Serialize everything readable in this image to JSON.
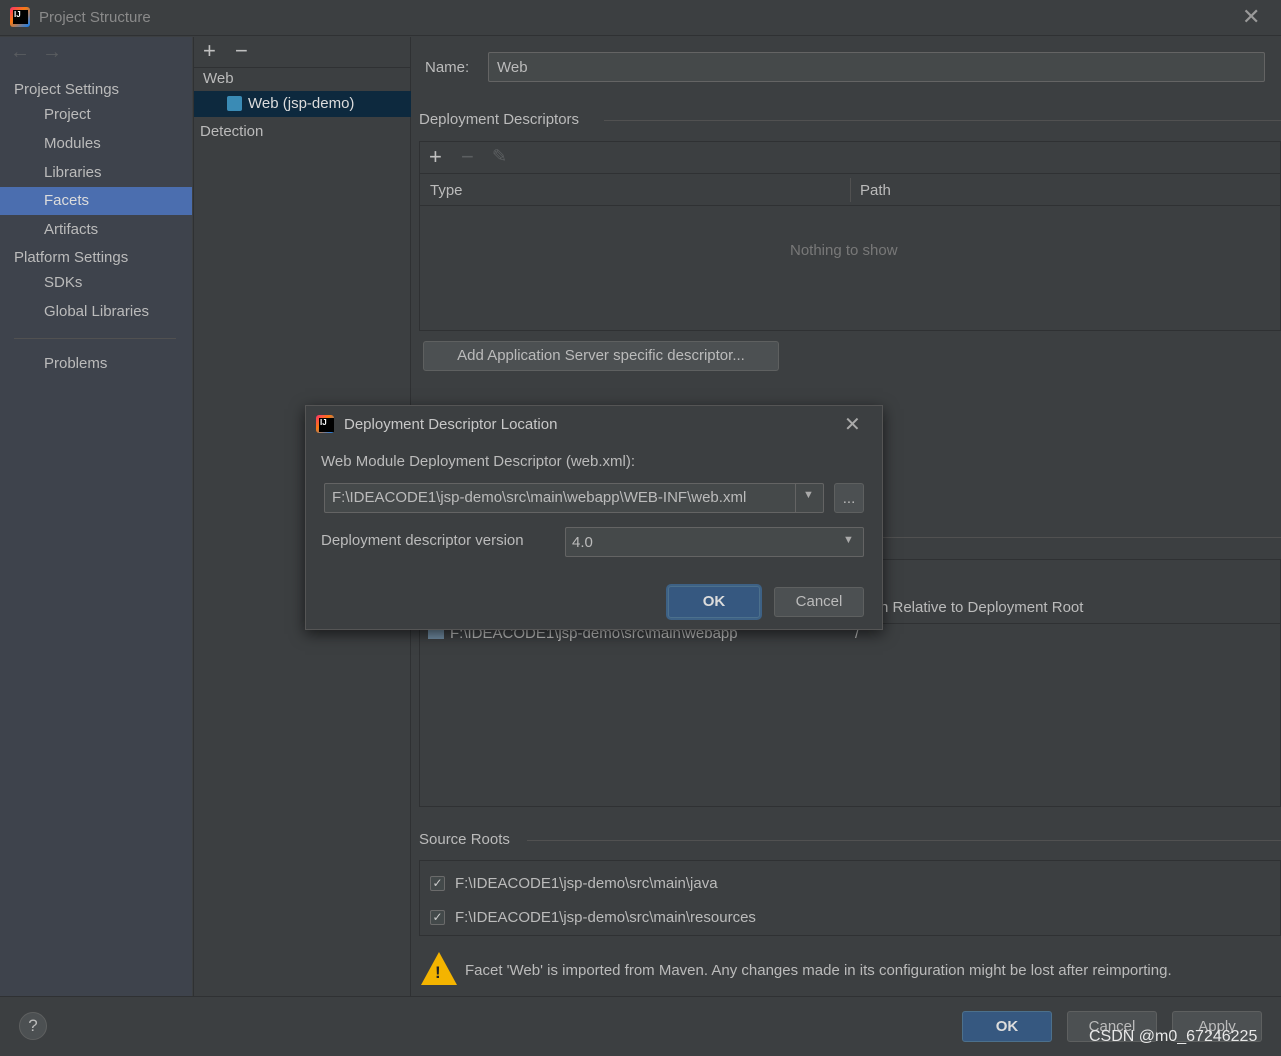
{
  "window": {
    "title": "Project Structure",
    "close_icon": "close-icon"
  },
  "sidebar": {
    "project_settings": "Project Settings",
    "items": [
      {
        "label": "Project"
      },
      {
        "label": "Modules"
      },
      {
        "label": "Libraries"
      },
      {
        "label": "Facets",
        "selected": true
      },
      {
        "label": "Artifacts"
      }
    ],
    "platform_settings": "Platform Settings",
    "platform_items": [
      {
        "label": "SDKs"
      },
      {
        "label": "Global Libraries"
      }
    ],
    "problems": "Problems"
  },
  "facet_tree": {
    "group": "Web",
    "selected_item": "Web (jsp-demo)",
    "detection": "Detection"
  },
  "main": {
    "name_label": "Name:",
    "name_value": "Web",
    "deployment_descriptors": "Deployment Descriptors",
    "table_headers": [
      "Type",
      "Path"
    ],
    "empty_text": "Nothing to show",
    "add_server_button": "Add Application Server specific descriptor...",
    "resource_header_partial": "h Relative to Deployment Root",
    "resource_row": {
      "path": "F:\\IDEACODE1\\jsp-demo\\src\\main\\webapp",
      "relative": "/"
    },
    "source_roots": "Source Roots",
    "source_root_items": [
      {
        "path": "F:\\IDEACODE1\\jsp-demo\\src\\main\\java",
        "checked": true
      },
      {
        "path": "F:\\IDEACODE1\\jsp-demo\\src\\main\\resources",
        "checked": true
      }
    ],
    "warning": "Facet 'Web' is imported from Maven. Any changes made in its configuration might be lost after reimporting."
  },
  "footer": {
    "help": "?",
    "ok": "OK",
    "cancel": "Cancel",
    "apply": "Apply",
    "watermark": "CSDN @m0_67246225"
  },
  "dialog": {
    "title": "Deployment Descriptor Location",
    "descriptor_label": "Web Module Deployment Descriptor (web.xml):",
    "descriptor_value": "F:\\IDEACODE1\\jsp-demo\\src\\main\\webapp\\WEB-INF\\web.xml",
    "browse": "...",
    "version_label": "Deployment descriptor version",
    "version_value": "4.0",
    "ok": "OK",
    "cancel": "Cancel"
  },
  "colors": {
    "selection": "#4b6eaf",
    "tree_selection": "#0d293e",
    "primary_button": "#365880",
    "background": "#3c3f41"
  }
}
